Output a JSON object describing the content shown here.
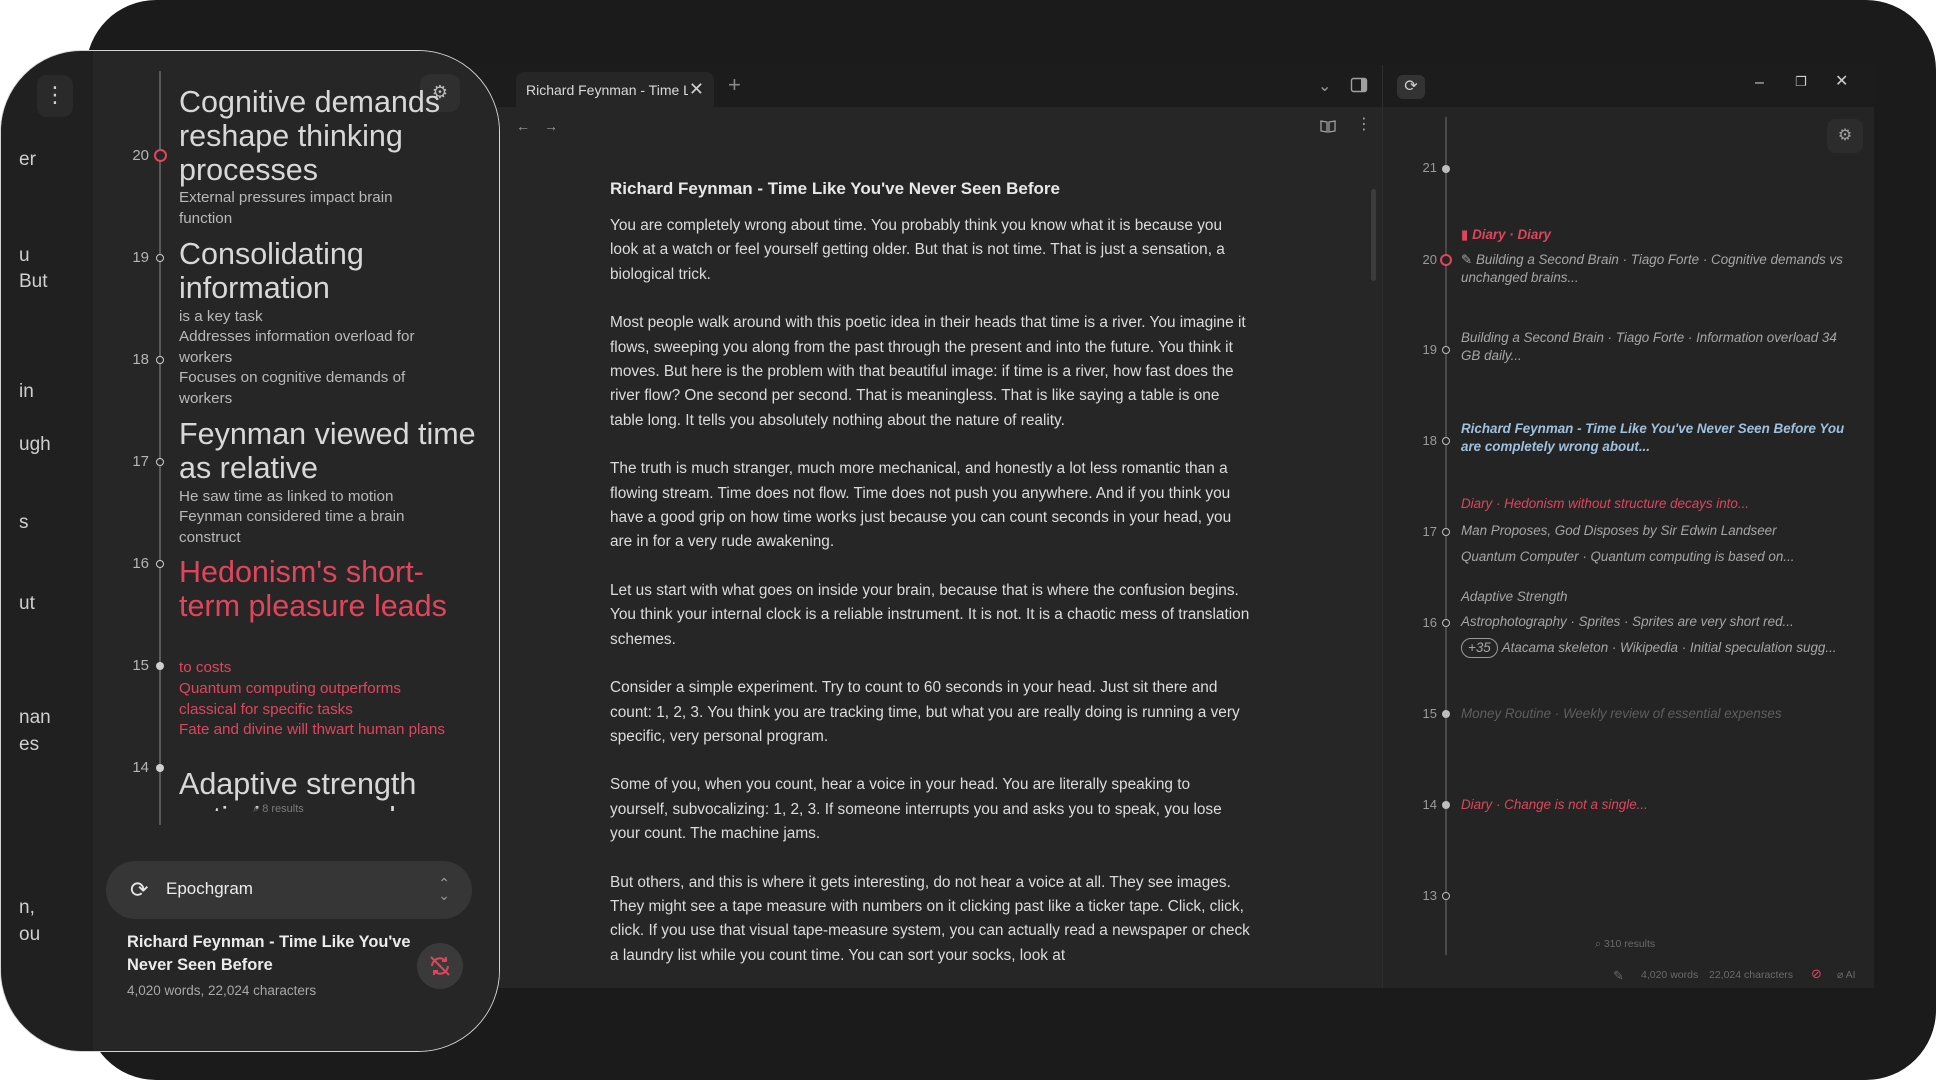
{
  "editor": {
    "tab_title": "Richard Feynman - Time Li...",
    "tab_close": "✕",
    "tab_add": "+",
    "doc_title": "Richard Feynman - Time Like You've Never Seen Before",
    "paragraphs": [
      "You are completely wrong about time. You probably think you know what it is because you look at a watch or feel yourself getting older. But that is not time. That is just a sensation, a biological trick.",
      "Most people walk around with this poetic idea in their heads that time is a river. You imagine it flows, sweeping you along from the past through the present and into the future. You think it moves. But here is the problem with that beautiful image: if time is a river, how fast does the river flow? One second per second. That is meaningless. That is like saying a table is one table long. It tells you absolutely nothing about the nature of reality.",
      "The truth is much stranger, much more mechanical, and honestly a lot less romantic than a flowing stream. Time does not flow. Time does not push you anywhere. And if you think you have a good grip on how time works just because you can count seconds in your head, you are in for a very rude awakening.",
      "Let us start with what goes on inside your brain, because that is where the confusion begins. You think your internal clock is a reliable instrument. It is not. It is a chaotic mess of translation schemes.",
      "Consider a simple experiment. Try to count to 60 seconds in your head. Just sit there and count: 1, 2, 3. You think you are tracking time, but what you are really doing is running a very specific, very personal program.",
      "Some of you, when you count, hear a voice in your head. You are literally speaking to yourself, subvocalizing: 1, 2, 3. If someone interrupts you and asks you to speak, you lose your count. The machine jams.",
      "But others, and this is where it gets interesting, do not hear a voice at all. They see images. They might see a tape measure with numbers on it clicking past like a ticker tape. Click, click, click. If you use that visual tape-measure system, you can actually read a newspaper or check a laundry list while you count time. You can sort your socks, look at"
    ]
  },
  "timeline_pane": {
    "numbers": [
      "21",
      "20",
      "19",
      "18",
      "17",
      "16",
      "15",
      "14",
      "13"
    ],
    "entries": {
      "e20_tag": "Diary · Diary",
      "e20_text": "Building a Second Brain · Tiago Forte · Cognitive demands vs unchanged brains...",
      "e19_text": "Building a Second Brain · Tiago Forte · Information overload 34 GB daily...",
      "e18_text": "Richard Feynman - Time Like You've Never Seen Before You are completely wrong about...",
      "e17a": "Diary · Hedonism without structure decays into...",
      "e17b": "Man Proposes, God Disposes by Sir Edwin Landseer",
      "e17c": "Quantum Computer · Quantum computing is based on...",
      "e16a": "Adaptive Strength",
      "e16b": "Astrophotography · Sprites · Sprites are very short red...",
      "e16c_pill": "+35",
      "e16c": "Atacama skeleton · Wikipedia · Initial speculation sugg...",
      "e15": "Money Routine · Weekly review of essential expenses",
      "e14": "Diary · Change is not a single..."
    },
    "results": "310 results",
    "status_words": "4,020 words",
    "status_chars": "22,024 characters",
    "status_ai": "AI"
  },
  "phone": {
    "frags": [
      "er",
      "u",
      "But",
      "in",
      "ugh",
      "s",
      "ut",
      "nan",
      "es",
      "n,",
      "ou"
    ],
    "numbers": [
      "20",
      "19",
      "18",
      "17",
      "16",
      "15",
      "14"
    ],
    "t1": "Cognitive demands reshape thinking processes",
    "t1_sub": "External pressures impact brain function",
    "t2": "Consolidating information",
    "t2_sub1": "is a key task",
    "t2_sub2": "Addresses information overload for workers",
    "t2_sub3": "Focuses on cognitive demands of workers",
    "t3": "Feynman viewed time as relative",
    "t3_sub1": "He saw time as linked to motion",
    "t3_sub2": "Feynman considered time a brain construct",
    "t4": "Hedonism's short-term pleasure leads",
    "t4_sub1": "to costs",
    "t4_sub2": "Quantum computing outperforms classical for specific tasks",
    "t4_sub3": "Fate and divine will thwart human plans",
    "t5": "Adaptive strength",
    "t5_partial": "optimizes muscle",
    "results": "8 results",
    "selector_label": "Epochgram",
    "now_playing_title": "Richard Feynman - Time Like You've Never Seen Before",
    "now_playing_meta": "4,020 words, 22,024 characters"
  },
  "colors": {
    "accent_red": "#e0455c",
    "link_blue": "#9fc0df",
    "bg_dark": "#1b1b1b"
  }
}
